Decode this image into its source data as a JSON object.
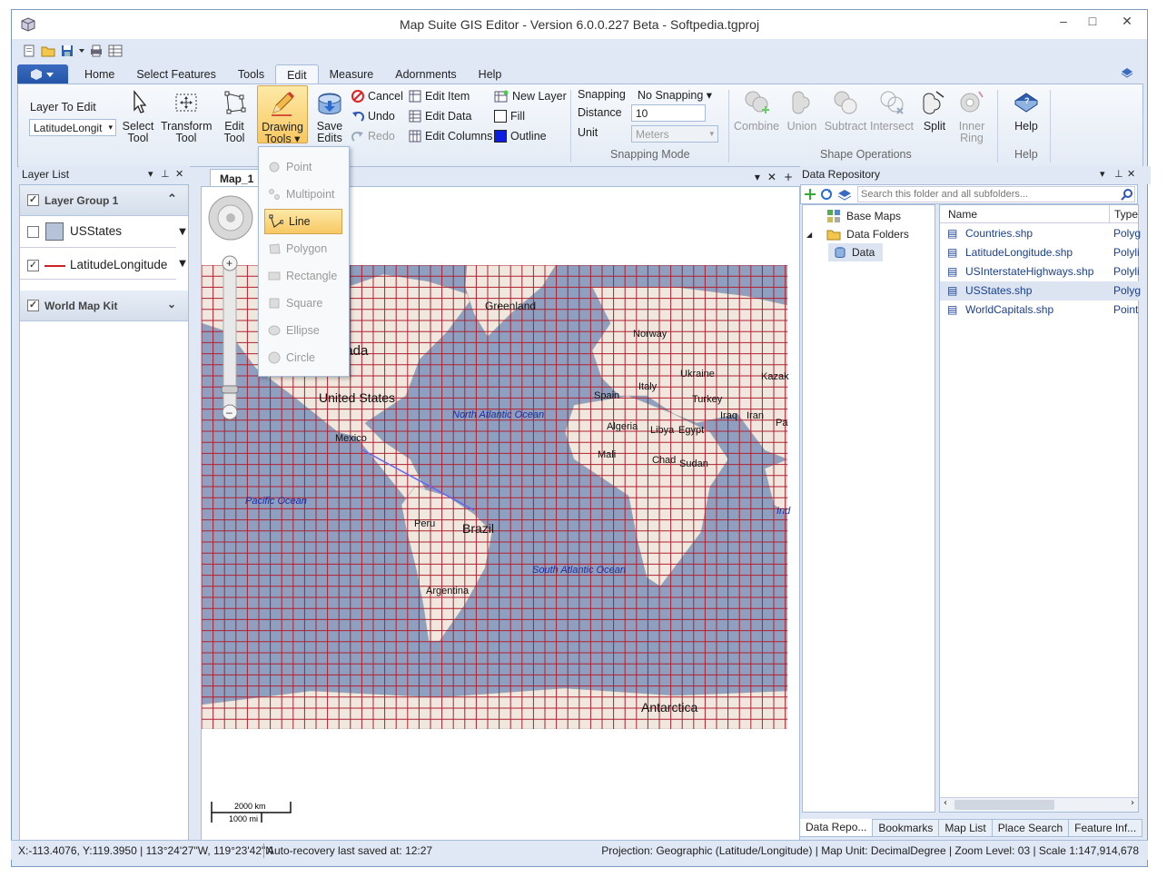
{
  "window": {
    "title": "Map Suite GIS Editor - Version 6.0.0.227 Beta - Softpedia.tgproj"
  },
  "tabs": [
    "Home",
    "Select Features",
    "Tools",
    "Edit",
    "Measure",
    "Adornments",
    "Help"
  ],
  "ribbon": {
    "layer_to_edit_label": "Layer To Edit",
    "layer_to_edit_value": "LatitudeLongit",
    "select_tool": [
      "Select",
      "Tool"
    ],
    "transform_tool": [
      "Transform",
      "Tool"
    ],
    "edit_tool": [
      "Edit",
      "Tool"
    ],
    "drawing_tools": [
      "Drawing",
      "Tools ▾"
    ],
    "save_edits": [
      "Save",
      "Edits"
    ],
    "cancel": "Cancel",
    "undo": "Undo",
    "redo": "Redo",
    "edit_item": "Edit Item",
    "edit_data": "Edit Data",
    "edit_columns": "Edit Columns",
    "new_layer": "New Layer",
    "fill": "Fill",
    "outline": "Outline",
    "snapping_label": "Snapping",
    "snapping_value": "No Snapping ▾",
    "distance_label": "Distance",
    "distance_value": "10",
    "unit_label": "Unit",
    "unit_value": "Meters",
    "snapping_group": "Snapping Mode",
    "combine": "Combine",
    "union": "Union",
    "subtract": "Subtract",
    "intersect": "Intersect",
    "split": "Split",
    "inner_ring": [
      "Inner",
      "Ring"
    ],
    "shape_ops_group": "Shape Operations",
    "help_btn": "Help",
    "help_group": "Help",
    "outline_color": "#0b1de0"
  },
  "drawing_menu": [
    "Point",
    "Multipoint",
    "Line",
    "Polygon",
    "Rectangle",
    "Square",
    "Ellipse",
    "Circle"
  ],
  "layer_list": {
    "title": "Layer List",
    "group1": "Layer Group 1",
    "layers": [
      "USStates",
      "LatitudeLongitude"
    ],
    "group2": "World Map Kit"
  },
  "map": {
    "tab": "Map_1",
    "labels": {
      "greenland": "Greenland",
      "canada": "nada",
      "norway": "Norway",
      "ukraine": "Ukraine",
      "kazak": "Kazak",
      "italy": "Italy",
      "spain": "Spain",
      "turkey": "Turkey",
      "us": "United States",
      "natl": "North Atlantic Ocean",
      "iraq": "Iraq",
      "iran": "Iran",
      "pa": "Pa",
      "algeria": "Algeria",
      "libya": "Libya",
      "egypt": "Egypt",
      "mexico": "Mexico",
      "mali": "Mali",
      "chad": "Chad",
      "sudan": "Sudan",
      "pacific": "Pacific Ocean",
      "ind": "Ind",
      "peru": "Peru",
      "brazil": "Brazil",
      "satl": "South Atlantic Ocean",
      "argentina": "Argentina",
      "antarctica": "Antarctica"
    },
    "scale_km": "2000 km",
    "scale_mi": "1000 mi"
  },
  "data_repo": {
    "title": "Data Repository",
    "search_placeholder": "Search this folder and all subfolders...",
    "tree": [
      "Base Maps",
      "Data Folders",
      "Data"
    ],
    "col_name": "Name",
    "col_type": "Type",
    "files": [
      {
        "name": "Countries.shp",
        "type": "Polyg"
      },
      {
        "name": "LatitudeLongitude.shp",
        "type": "Polyli"
      },
      {
        "name": "USInterstateHighways.shp",
        "type": "Polyli"
      },
      {
        "name": "USStates.shp",
        "type": "Polyg"
      },
      {
        "name": "WorldCapitals.shp",
        "type": "Point"
      }
    ]
  },
  "bottom_tabs": [
    "Data Repo...",
    "Bookmarks",
    "Map List",
    "Place Search",
    "Feature Inf..."
  ],
  "status": {
    "coords": "X:-113.4076, Y:119.3950 | 113°24'27\"W, 119°23'42\"N",
    "autosave": "Auto-recovery last saved at: 12:27",
    "right": "Projection: Geographic (Latitude/Longitude) | Map Unit: DecimalDegree | Zoom Level: 03 | Scale 1:147,914,678"
  }
}
